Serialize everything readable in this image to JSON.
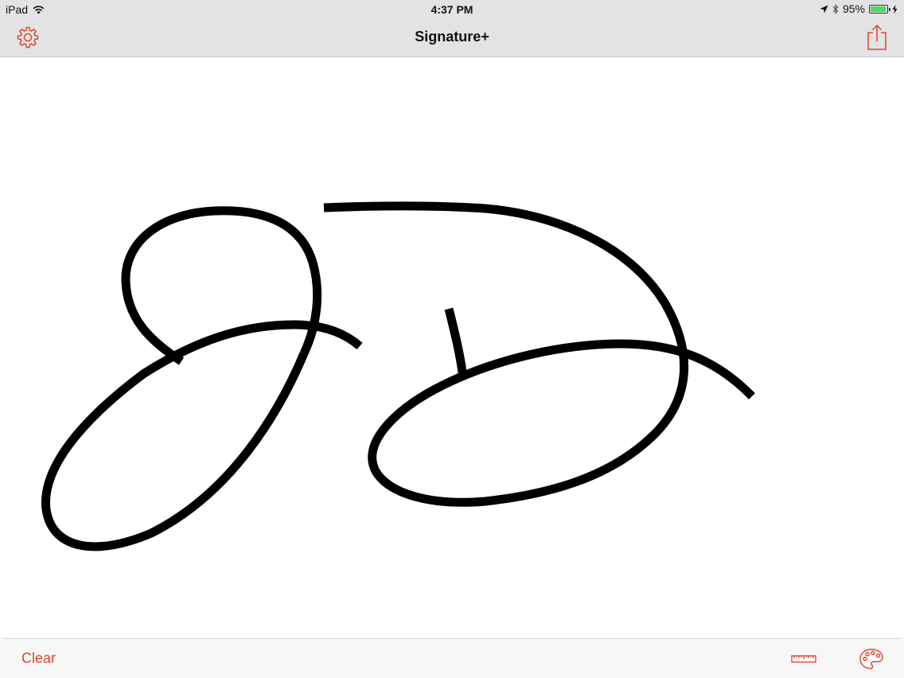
{
  "status_bar": {
    "device": "iPad",
    "time": "4:37 PM",
    "battery_percent": "95%",
    "battery_level": 0.95
  },
  "nav_bar": {
    "title": "Signature+",
    "left_icon": "gear-icon",
    "right_icon": "share-icon"
  },
  "toolbar": {
    "clear_label": "Clear",
    "ruler_icon": "ruler-icon",
    "palette_icon": "palette-icon"
  },
  "colors": {
    "accent": "#e0452c",
    "ink": "#000000",
    "bar_background": "#e3e3e5",
    "battery_fill": "#4cd964"
  }
}
